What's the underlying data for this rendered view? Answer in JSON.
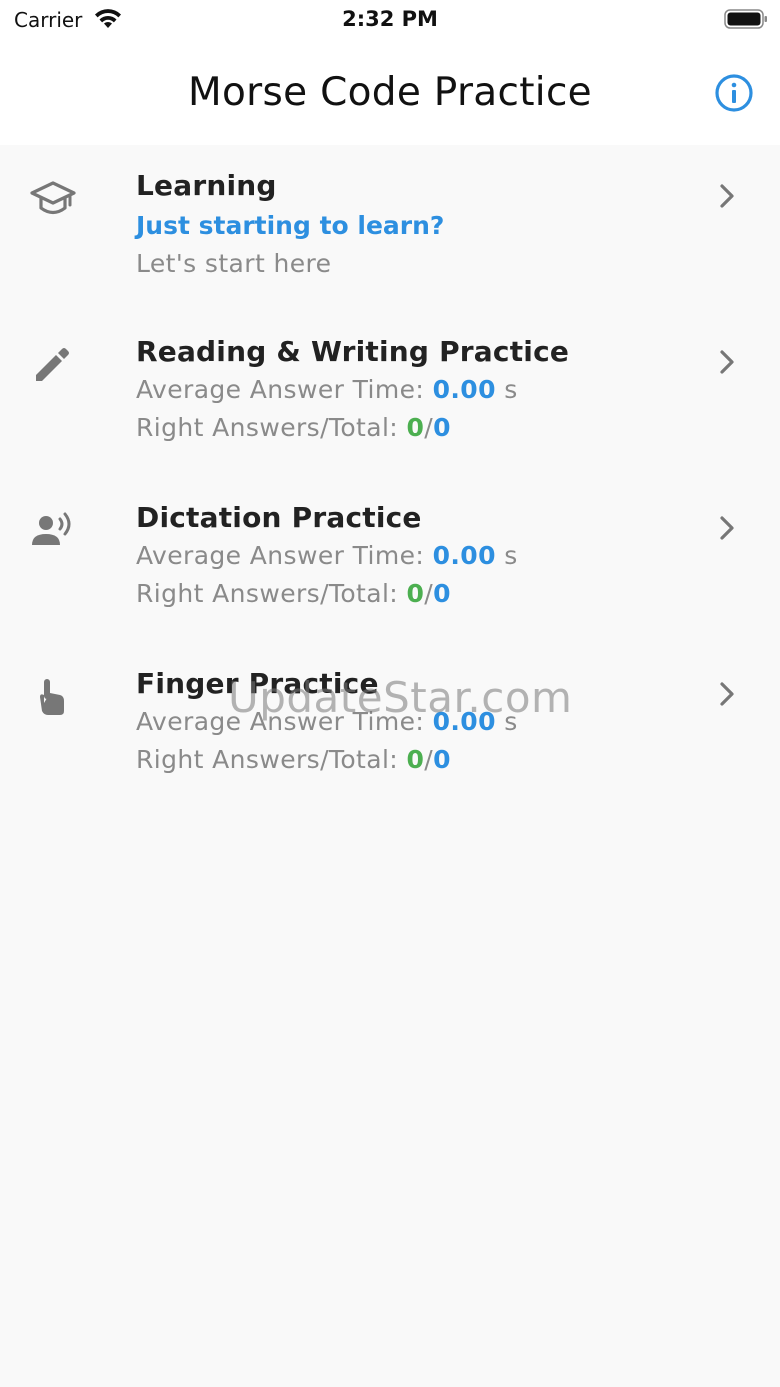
{
  "status_bar": {
    "carrier": "Carrier",
    "time": "2:32 PM",
    "wifi_icon": "wifi-icon",
    "battery_icon": "battery-icon"
  },
  "nav": {
    "title": "Morse Code Practice",
    "info_icon": "info-icon"
  },
  "colors": {
    "accent_blue": "#2d8fe0",
    "success_green": "#4caf50",
    "secondary_text": "#8a8a8a",
    "background": "#f9f9f9"
  },
  "rows": [
    {
      "icon": "graduation-cap-icon",
      "title": "Learning",
      "subtitle": "Just starting to learn?",
      "detail": "Let's start here"
    },
    {
      "icon": "pencil-icon",
      "title": "Reading & Writing Practice",
      "avg_label": "Average Answer Time:",
      "avg_value": "0.00",
      "avg_unit": "s",
      "right_label": "Right Answers/Total:",
      "right_value": "0",
      "separator": "/",
      "total_value": "0"
    },
    {
      "icon": "speaking-person-icon",
      "title": "Dictation Practice",
      "avg_label": "Average Answer Time:",
      "avg_value": "0.00",
      "avg_unit": "s",
      "right_label": "Right Answers/Total:",
      "right_value": "0",
      "separator": "/",
      "total_value": "0"
    },
    {
      "icon": "finger-tap-icon",
      "title": "Finger Practice",
      "avg_label": "Average Answer Time:",
      "avg_value": "0.00",
      "avg_unit": "s",
      "right_label": "Right Answers/Total:",
      "right_value": "0",
      "separator": "/",
      "total_value": "0"
    }
  ],
  "watermark": "UpdateStar.com"
}
